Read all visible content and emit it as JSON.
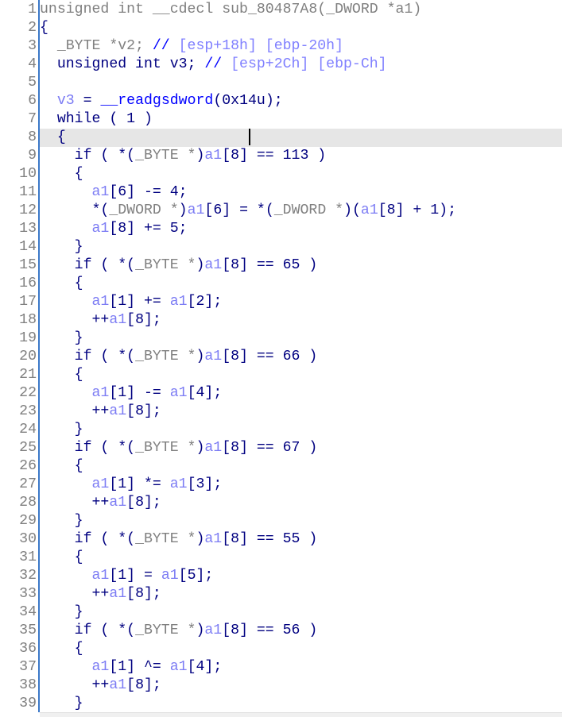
{
  "editor": {
    "view": "pseudocode",
    "highlighted_line": 8,
    "colors": {
      "keyword": "#000080",
      "type": "#808080",
      "variable": "#7c7cf4",
      "comment": "#0000ff",
      "comment_detail": "#8080ff",
      "function": "#0000ff",
      "highlight": "#e6e6e6"
    },
    "lines": [
      {
        "n": "1",
        "tokens": [
          [
            "t",
            "unsigned int __cdecl sub_80487A8(_DWORD *a1)"
          ]
        ]
      },
      {
        "n": "2",
        "tokens": [
          [
            "k",
            "{"
          ]
        ]
      },
      {
        "n": "3",
        "tokens": [
          [
            "t",
            "  _BYTE *v2; "
          ],
          [
            "c",
            "// "
          ],
          [
            "cv",
            "[esp+18h] [ebp-20h]"
          ]
        ]
      },
      {
        "n": "4",
        "tokens": [
          [
            "k",
            "  unsigned int v3; "
          ],
          [
            "c",
            "// "
          ],
          [
            "cv",
            "[esp+2Ch] [ebp-Ch]"
          ]
        ]
      },
      {
        "n": "5",
        "tokens": []
      },
      {
        "n": "6",
        "tokens": [
          [
            "k",
            "  "
          ],
          [
            "v",
            "v3"
          ],
          [
            "k",
            " = "
          ],
          [
            "f",
            "__readgsdword"
          ],
          [
            "k",
            "(0x14u);"
          ]
        ]
      },
      {
        "n": "7",
        "tokens": [
          [
            "k",
            "  while ( 1 )"
          ]
        ]
      },
      {
        "n": "8",
        "tokens": [
          [
            "k",
            "  {"
          ]
        ]
      },
      {
        "n": "9",
        "tokens": [
          [
            "k",
            "    if ( *("
          ],
          [
            "t",
            "_BYTE *"
          ],
          [
            "k",
            ")"
          ],
          [
            "v",
            "a1"
          ],
          [
            "k",
            "[8] == 113 )"
          ]
        ]
      },
      {
        "n": "10",
        "tokens": [
          [
            "k",
            "    {"
          ]
        ]
      },
      {
        "n": "11",
        "tokens": [
          [
            "k",
            "      "
          ],
          [
            "v",
            "a1"
          ],
          [
            "k",
            "[6] -= 4;"
          ]
        ]
      },
      {
        "n": "12",
        "tokens": [
          [
            "k",
            "      *("
          ],
          [
            "t",
            "_DWORD *"
          ],
          [
            "k",
            ")"
          ],
          [
            "v",
            "a1"
          ],
          [
            "k",
            "[6] = *("
          ],
          [
            "t",
            "_DWORD *"
          ],
          [
            "k",
            ")("
          ],
          [
            "v",
            "a1"
          ],
          [
            "k",
            "[8] + 1);"
          ]
        ]
      },
      {
        "n": "13",
        "tokens": [
          [
            "k",
            "      "
          ],
          [
            "v",
            "a1"
          ],
          [
            "k",
            "[8] += 5;"
          ]
        ]
      },
      {
        "n": "14",
        "tokens": [
          [
            "k",
            "    }"
          ]
        ]
      },
      {
        "n": "15",
        "tokens": [
          [
            "k",
            "    if ( *("
          ],
          [
            "t",
            "_BYTE *"
          ],
          [
            "k",
            ")"
          ],
          [
            "v",
            "a1"
          ],
          [
            "k",
            "[8] == 65 )"
          ]
        ]
      },
      {
        "n": "16",
        "tokens": [
          [
            "k",
            "    {"
          ]
        ]
      },
      {
        "n": "17",
        "tokens": [
          [
            "k",
            "      "
          ],
          [
            "v",
            "a1"
          ],
          [
            "k",
            "[1] += "
          ],
          [
            "v",
            "a1"
          ],
          [
            "k",
            "[2];"
          ]
        ]
      },
      {
        "n": "18",
        "tokens": [
          [
            "k",
            "      ++"
          ],
          [
            "v",
            "a1"
          ],
          [
            "k",
            "[8];"
          ]
        ]
      },
      {
        "n": "19",
        "tokens": [
          [
            "k",
            "    }"
          ]
        ]
      },
      {
        "n": "20",
        "tokens": [
          [
            "k",
            "    if ( *("
          ],
          [
            "t",
            "_BYTE *"
          ],
          [
            "k",
            ")"
          ],
          [
            "v",
            "a1"
          ],
          [
            "k",
            "[8] == 66 )"
          ]
        ]
      },
      {
        "n": "21",
        "tokens": [
          [
            "k",
            "    {"
          ]
        ]
      },
      {
        "n": "22",
        "tokens": [
          [
            "k",
            "      "
          ],
          [
            "v",
            "a1"
          ],
          [
            "k",
            "[1] -= "
          ],
          [
            "v",
            "a1"
          ],
          [
            "k",
            "[4];"
          ]
        ]
      },
      {
        "n": "23",
        "tokens": [
          [
            "k",
            "      ++"
          ],
          [
            "v",
            "a1"
          ],
          [
            "k",
            "[8];"
          ]
        ]
      },
      {
        "n": "24",
        "tokens": [
          [
            "k",
            "    }"
          ]
        ]
      },
      {
        "n": "25",
        "tokens": [
          [
            "k",
            "    if ( *("
          ],
          [
            "t",
            "_BYTE *"
          ],
          [
            "k",
            ")"
          ],
          [
            "v",
            "a1"
          ],
          [
            "k",
            "[8] == 67 )"
          ]
        ]
      },
      {
        "n": "26",
        "tokens": [
          [
            "k",
            "    {"
          ]
        ]
      },
      {
        "n": "27",
        "tokens": [
          [
            "k",
            "      "
          ],
          [
            "v",
            "a1"
          ],
          [
            "k",
            "[1] *= "
          ],
          [
            "v",
            "a1"
          ],
          [
            "k",
            "[3];"
          ]
        ]
      },
      {
        "n": "28",
        "tokens": [
          [
            "k",
            "      ++"
          ],
          [
            "v",
            "a1"
          ],
          [
            "k",
            "[8];"
          ]
        ]
      },
      {
        "n": "29",
        "tokens": [
          [
            "k",
            "    }"
          ]
        ]
      },
      {
        "n": "30",
        "tokens": [
          [
            "k",
            "    if ( *("
          ],
          [
            "t",
            "_BYTE *"
          ],
          [
            "k",
            ")"
          ],
          [
            "v",
            "a1"
          ],
          [
            "k",
            "[8] == 55 )"
          ]
        ]
      },
      {
        "n": "31",
        "tokens": [
          [
            "k",
            "    {"
          ]
        ]
      },
      {
        "n": "32",
        "tokens": [
          [
            "k",
            "      "
          ],
          [
            "v",
            "a1"
          ],
          [
            "k",
            "[1] = "
          ],
          [
            "v",
            "a1"
          ],
          [
            "k",
            "[5];"
          ]
        ]
      },
      {
        "n": "33",
        "tokens": [
          [
            "k",
            "      ++"
          ],
          [
            "v",
            "a1"
          ],
          [
            "k",
            "[8];"
          ]
        ]
      },
      {
        "n": "34",
        "tokens": [
          [
            "k",
            "    }"
          ]
        ]
      },
      {
        "n": "35",
        "tokens": [
          [
            "k",
            "    if ( *("
          ],
          [
            "t",
            "_BYTE *"
          ],
          [
            "k",
            ")"
          ],
          [
            "v",
            "a1"
          ],
          [
            "k",
            "[8] == 56 )"
          ]
        ]
      },
      {
        "n": "36",
        "tokens": [
          [
            "k",
            "    {"
          ]
        ]
      },
      {
        "n": "37",
        "tokens": [
          [
            "k",
            "      "
          ],
          [
            "v",
            "a1"
          ],
          [
            "k",
            "[1] ^= "
          ],
          [
            "v",
            "a1"
          ],
          [
            "k",
            "[4];"
          ]
        ]
      },
      {
        "n": "38",
        "tokens": [
          [
            "k",
            "      ++"
          ],
          [
            "v",
            "a1"
          ],
          [
            "k",
            "[8];"
          ]
        ]
      },
      {
        "n": "39",
        "tokens": [
          [
            "k",
            "    }"
          ]
        ]
      }
    ]
  }
}
